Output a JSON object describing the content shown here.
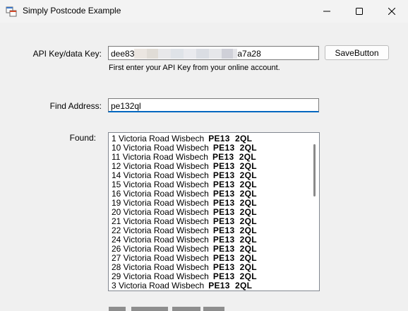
{
  "window": {
    "title": "Simply Postcode Example",
    "controls": {
      "minimize": "minimize-icon",
      "maximize": "maximize-icon",
      "close": "close-icon"
    }
  },
  "api_key": {
    "label": "API Key/data Key:",
    "value_prefix": "dee83",
    "value_suffix": "a7a28",
    "hint": "First enter your API Key from your online account."
  },
  "save_button": {
    "label": "SaveButton"
  },
  "find": {
    "label": "Find Address:",
    "value": "pe132ql"
  },
  "found": {
    "label": "Found:",
    "items": [
      {
        "address": "1 Victoria Road Wisbech",
        "postcode": "PE13  2QL"
      },
      {
        "address": "10 Victoria Road Wisbech",
        "postcode": "PE13  2QL"
      },
      {
        "address": "11 Victoria Road Wisbech",
        "postcode": "PE13  2QL"
      },
      {
        "address": "12 Victoria Road Wisbech",
        "postcode": "PE13  2QL"
      },
      {
        "address": "14 Victoria Road Wisbech",
        "postcode": "PE13  2QL"
      },
      {
        "address": "15 Victoria Road Wisbech",
        "postcode": "PE13  2QL"
      },
      {
        "address": "16 Victoria Road Wisbech",
        "postcode": "PE13  2QL"
      },
      {
        "address": "19 Victoria Road Wisbech",
        "postcode": "PE13  2QL"
      },
      {
        "address": "20 Victoria Road Wisbech",
        "postcode": "PE13  2QL"
      },
      {
        "address": "21 Victoria Road Wisbech",
        "postcode": "PE13  2QL"
      },
      {
        "address": "22 Victoria Road Wisbech",
        "postcode": "PE13  2QL"
      },
      {
        "address": "24 Victoria Road Wisbech",
        "postcode": "PE13  2QL"
      },
      {
        "address": "26 Victoria Road Wisbech",
        "postcode": "PE13  2QL"
      },
      {
        "address": "27 Victoria Road Wisbech",
        "postcode": "PE13  2QL"
      },
      {
        "address": "28 Victoria Road Wisbech",
        "postcode": "PE13  2QL"
      },
      {
        "address": "29 Victoria Road Wisbech",
        "postcode": "PE13  2QL"
      },
      {
        "address": "3 Victoria Road Wisbech",
        "postcode": "PE13  2QL"
      }
    ]
  },
  "colors": {
    "window_bg": "#f0f0f0",
    "focus_underline": "#0067c0",
    "text": "#000000"
  }
}
